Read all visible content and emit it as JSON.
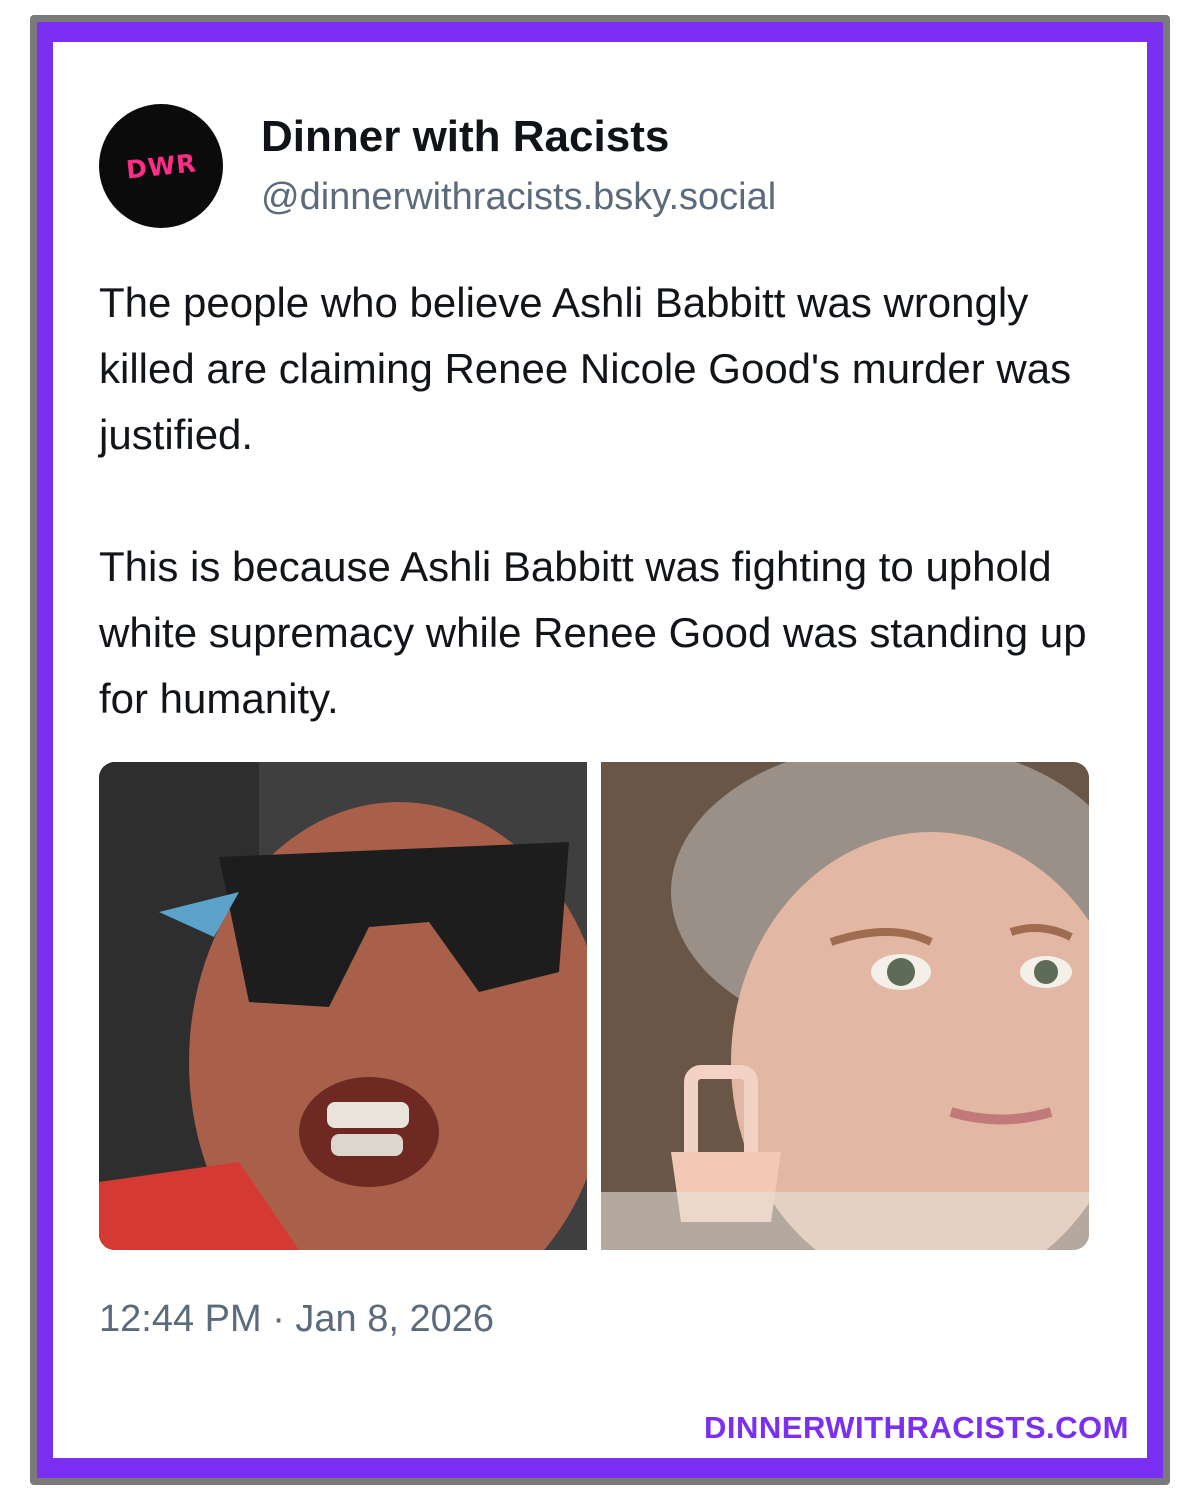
{
  "post": {
    "avatar_text": "DWR",
    "display_name": "Dinner with Racists",
    "handle": "@dinnerwithracists.bsky.social",
    "paragraphs": [
      "The people who believe Ashli Babbitt was wrongly killed are claiming Renee Nicole Good's murder was justified.",
      "This is because Ashli Babbitt was fighting to uphold white supremacy while Renee Good was standing up for humanity."
    ],
    "timestamp": "12:44 PM · Jan 8, 2026"
  },
  "watermark": "DINNERWITHRACISTS.COM",
  "colors": {
    "frame_purple": "#7b2ff2",
    "avatar_bg": "#0b0b0b",
    "avatar_text": "#ff2d87",
    "name_text": "#101418",
    "muted_text": "#5b6b7c"
  }
}
